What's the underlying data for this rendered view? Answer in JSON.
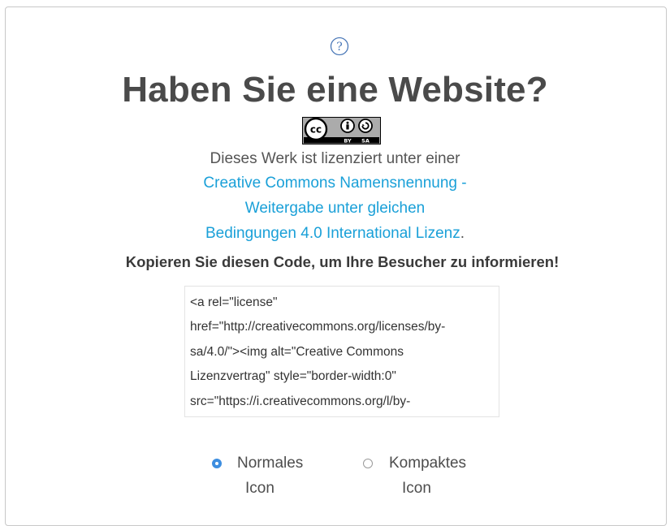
{
  "header": {
    "help_icon": "question-circle-icon",
    "title": "Haben Sie eine Website?"
  },
  "badge": {
    "icon": "cc-by-sa-badge",
    "cc_text": "cc",
    "by_text": "BY",
    "sa_text": "SA"
  },
  "license": {
    "intro": "Dieses Werk ist lizenziert unter einer",
    "link_line1": "Creative Commons Namensnennung -",
    "link_line2": "Weitergabe unter gleichen",
    "link_line3": "Bedingungen 4.0 International Lizenz",
    "period": ".",
    "link_color": "#1aa0d8"
  },
  "instruction": "Kopieren Sie diesen Code, um Ihre Besucher zu informieren!",
  "code": {
    "lines": [
      "<a rel=\"license\"",
      "href=\"http://creativecommons.org/licenses/by-",
      "sa/4.0/\"><img alt=\"Creative Commons",
      "Lizenzvertrag\" style=\"border-width:0\"",
      "src=\"https://i.creativecommons.org/l/by-"
    ]
  },
  "icon_options": [
    {
      "line1": "Normales",
      "line2": "Icon",
      "selected": true
    },
    {
      "line1": "Kompaktes",
      "line2": "Icon",
      "selected": false
    }
  ],
  "colors": {
    "radio_selected": "#3d8ee0",
    "title": "#4a4a4a"
  }
}
